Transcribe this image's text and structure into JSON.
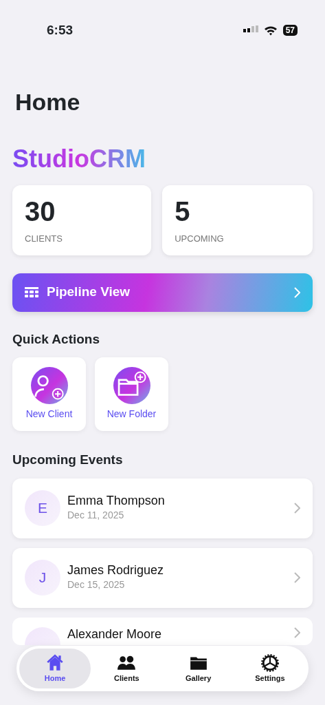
{
  "status_bar": {
    "time": "6:53",
    "battery": "57"
  },
  "title": "Home",
  "brand": "StudioCRM",
  "stats": [
    {
      "value": "30",
      "label": "CLIENTS"
    },
    {
      "value": "5",
      "label": "UPCOMING"
    }
  ],
  "pipeline": {
    "label": "Pipeline View"
  },
  "quick_actions": {
    "heading": "Quick Actions",
    "items": [
      {
        "kind": "client",
        "label": "New Client"
      },
      {
        "kind": "folder",
        "label": "New Folder"
      }
    ]
  },
  "events": {
    "heading": "Upcoming Events",
    "items": [
      {
        "initial": "E",
        "name": "Emma Thompson",
        "date": "Dec 11, 2025"
      },
      {
        "initial": "J",
        "name": "James Rodriguez",
        "date": "Dec 15, 2025"
      },
      {
        "name": "Alexander Moore"
      }
    ]
  },
  "tab_bar": [
    {
      "kind": "home",
      "label": "Home",
      "selected": true
    },
    {
      "kind": "clients",
      "label": "Clients",
      "selected": false
    },
    {
      "kind": "gallery",
      "label": "Gallery",
      "selected": false
    },
    {
      "kind": "settings",
      "label": "Settings",
      "selected": false
    }
  ]
}
